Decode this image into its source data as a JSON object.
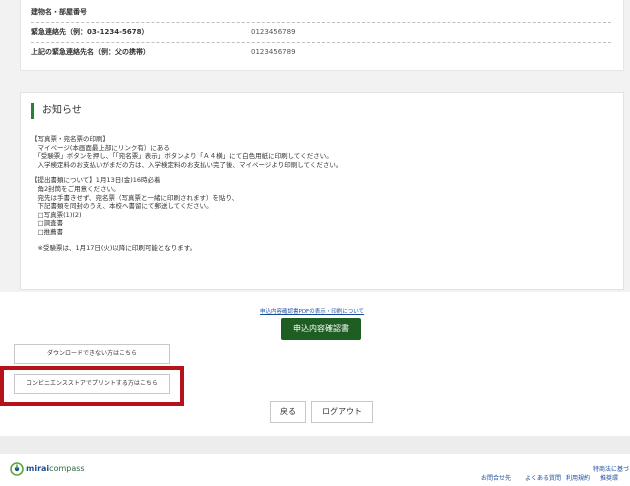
{
  "contact_table": {
    "rows": [
      {
        "label": "建物名・部屋番号",
        "value": ""
      },
      {
        "label": "緊急連絡先（例：03-1234-5678）",
        "value": "0123456789"
      },
      {
        "label": "上記の緊急連絡先名（例：父の携帯）",
        "value": "0123456789"
      }
    ]
  },
  "notice": {
    "title": "お知らせ",
    "lines": [
      "【写真票・宛名票の印刷】",
      "　マイページ(本画面最上部にリンク有）にある",
      "　「受験票」ボタンを押し、「「宛名票」表示」ボタンより「Ａ４横」にて白色用紙に印刷してください。",
      "　入学検定料のお支払いがまだの方は、入学検定料のお支払い完了後、マイページより印刷してください。",
      "",
      "【提出書類について】1月13日(金)16時必着",
      "　角2封筒をご用意ください。",
      "　宛先は手書きせず、宛名票（写真票と一緒に印刷されます）を貼り、",
      "　下記書類を同封のうえ、本校へ書留にて郵送してください。",
      "　□写真票(1)(2)",
      "　□調査書",
      "　□推薦書",
      "",
      "　※受験票は、1月17日(火)以降に印刷可能となります。"
    ]
  },
  "actions": {
    "pdf_link": "申込内容確認書PDFの表示・印刷について",
    "confirm_button": "申込内容確認書",
    "download_help": "ダウンロードできない方はこちら",
    "convenience_print": "コンビニエンスストアでプリントする方はこちら",
    "back_button": "戻る",
    "logout_button": "ログアウト"
  },
  "footer": {
    "logo_bold": "mirai",
    "logo_rest": "compass",
    "contact": "お問合せ先",
    "faq": "よくある質問",
    "terms": "利用規約",
    "env": "推奨環",
    "legal": "特商法に基づく表示"
  },
  "colors": {
    "accent_green": "#1e5e22",
    "highlight_red": "#b5121b",
    "link_blue": "#1a4c9c"
  }
}
